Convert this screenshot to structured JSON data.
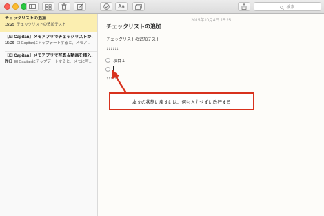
{
  "toolbar": {
    "font_button": "Aa",
    "search_placeholder": "検索"
  },
  "sidebar": {
    "notes": [
      {
        "title": "チェックリストの追加",
        "time": "15:25",
        "preview": "チェックリストの追加テスト",
        "selected": true
      },
      {
        "title": "【El Capitan】メモアプリでチェックリストが…",
        "time": "15:25",
        "preview": "El Capitanにアップデートすると、メモア…",
        "selected": false
      },
      {
        "title": "【El Capitan】メモアプリで写真＆動画を挿入…",
        "time": "昨日",
        "preview": "El Capitanにアップデートすると、メモに写…",
        "selected": false
      }
    ]
  },
  "editor": {
    "date": "2015年10月4日 15:25",
    "title": "チェックリストの追加",
    "body_line": "チェックリストの追加テスト",
    "arrows_down": "↓↓↓↓↓↓",
    "checklist": [
      {
        "label": "項目１",
        "checked": false
      },
      {
        "label": "",
        "checked": false
      }
    ],
    "arrows_up": "↑↑↑↑↑↑"
  },
  "callout": {
    "text": "本文の状態に戻すには、何も入力せずに改行する",
    "color": "#d8321e"
  }
}
